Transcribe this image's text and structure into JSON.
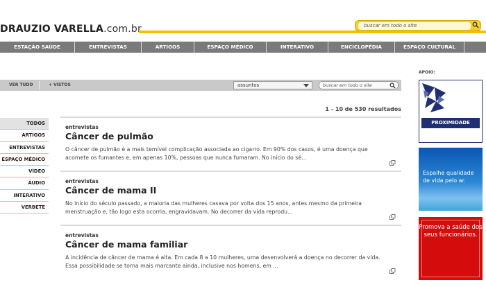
{
  "header": {
    "logo_primary": "DRAUZIO VARELLA",
    "logo_domain": ".com.br",
    "search_placeholder": "buscar em todo o site",
    "accent_color": "#f2c200"
  },
  "nav": {
    "items": [
      {
        "label": "ESTAÇÃO SAÚDE"
      },
      {
        "label": "ENTREVISTAS"
      },
      {
        "label": "ARTIGOS"
      },
      {
        "label": "ESPAÇO MÉDICO"
      },
      {
        "label": "INTERATIVO"
      },
      {
        "label": "ENCICLOPÉDIA"
      },
      {
        "label": "ESPAÇO CULTURAL"
      }
    ]
  },
  "filter_bar": {
    "view_all": "VER TUDO",
    "most_viewed": "+ VISTOS",
    "subjects_select": "assuntos",
    "search_placeholder": "buscar em todo o site"
  },
  "results_summary": "1 - 10 de 530 resultados",
  "sidebar": {
    "items": [
      {
        "label": "TODOS",
        "active": true
      },
      {
        "label": "ARTIGOS"
      },
      {
        "label": "ENTREVISTAS"
      },
      {
        "label": "ESPAÇO MÉDICO"
      },
      {
        "label": "VÍDEO"
      },
      {
        "label": "ÁUDIO"
      },
      {
        "label": "INTERATIVO"
      },
      {
        "label": "VERBETE"
      }
    ]
  },
  "results": [
    {
      "category": "entrevistas",
      "title": "Câncer de pulmão",
      "excerpt": "O câncer de pulmão é a mais temível complicação associada ao cigarro. Em 90% dos casos, é uma doença que acomete os fumantes e, em apenas 10%, pessoas que nunca fumaram. No início do sé..."
    },
    {
      "category": "entrevistas",
      "title": "Câncer de mama II",
      "excerpt": "No início do século passado, a maioria das mulheres casava por volta dos 15 anos, antes mesmo da primeira menstruação e, tão logo esta ocorria, engravidavam. No decorrer da vida reprodu..."
    },
    {
      "category": "entrevistas",
      "title": "Câncer de mama familiar",
      "excerpt": "A incidência de câncer de mama é alta. Em cada 8 a 10 mulheres, uma desenvolverá a doença no decorrer da vida. Essa possibilidade se torna mais marcante ainda, inclusive nos homens, em ..."
    }
  ],
  "sponsors": {
    "label": "APOIO:",
    "ad1_text": "PROXIMIDADE",
    "ad2_text": "Espalhe qualidade de vida pelo ar.",
    "ad3_text": "Promova a saúde dos seus funcionários."
  }
}
